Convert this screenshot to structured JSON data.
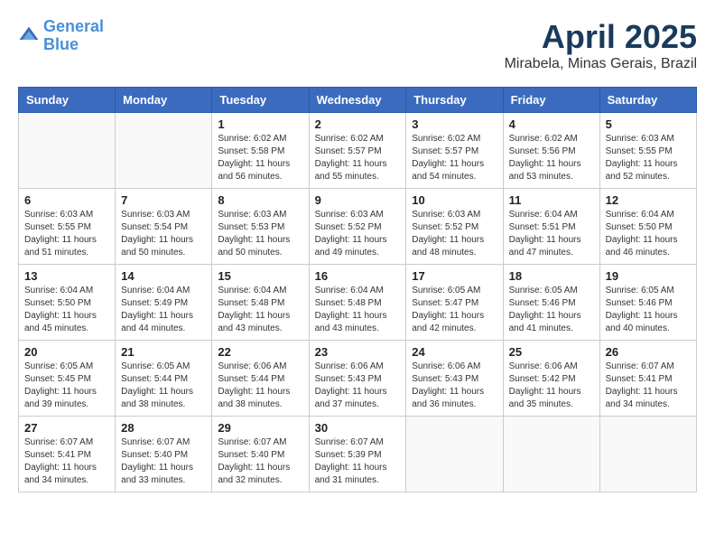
{
  "logo": {
    "line1": "General",
    "line2": "Blue"
  },
  "title": "April 2025",
  "subtitle": "Mirabela, Minas Gerais, Brazil",
  "days_of_week": [
    "Sunday",
    "Monday",
    "Tuesday",
    "Wednesday",
    "Thursday",
    "Friday",
    "Saturday"
  ],
  "weeks": [
    [
      {
        "day": "",
        "detail": ""
      },
      {
        "day": "",
        "detail": ""
      },
      {
        "day": "1",
        "detail": "Sunrise: 6:02 AM\nSunset: 5:58 PM\nDaylight: 11 hours and 56 minutes."
      },
      {
        "day": "2",
        "detail": "Sunrise: 6:02 AM\nSunset: 5:57 PM\nDaylight: 11 hours and 55 minutes."
      },
      {
        "day": "3",
        "detail": "Sunrise: 6:02 AM\nSunset: 5:57 PM\nDaylight: 11 hours and 54 minutes."
      },
      {
        "day": "4",
        "detail": "Sunrise: 6:02 AM\nSunset: 5:56 PM\nDaylight: 11 hours and 53 minutes."
      },
      {
        "day": "5",
        "detail": "Sunrise: 6:03 AM\nSunset: 5:55 PM\nDaylight: 11 hours and 52 minutes."
      }
    ],
    [
      {
        "day": "6",
        "detail": "Sunrise: 6:03 AM\nSunset: 5:55 PM\nDaylight: 11 hours and 51 minutes."
      },
      {
        "day": "7",
        "detail": "Sunrise: 6:03 AM\nSunset: 5:54 PM\nDaylight: 11 hours and 50 minutes."
      },
      {
        "day": "8",
        "detail": "Sunrise: 6:03 AM\nSunset: 5:53 PM\nDaylight: 11 hours and 50 minutes."
      },
      {
        "day": "9",
        "detail": "Sunrise: 6:03 AM\nSunset: 5:52 PM\nDaylight: 11 hours and 49 minutes."
      },
      {
        "day": "10",
        "detail": "Sunrise: 6:03 AM\nSunset: 5:52 PM\nDaylight: 11 hours and 48 minutes."
      },
      {
        "day": "11",
        "detail": "Sunrise: 6:04 AM\nSunset: 5:51 PM\nDaylight: 11 hours and 47 minutes."
      },
      {
        "day": "12",
        "detail": "Sunrise: 6:04 AM\nSunset: 5:50 PM\nDaylight: 11 hours and 46 minutes."
      }
    ],
    [
      {
        "day": "13",
        "detail": "Sunrise: 6:04 AM\nSunset: 5:50 PM\nDaylight: 11 hours and 45 minutes."
      },
      {
        "day": "14",
        "detail": "Sunrise: 6:04 AM\nSunset: 5:49 PM\nDaylight: 11 hours and 44 minutes."
      },
      {
        "day": "15",
        "detail": "Sunrise: 6:04 AM\nSunset: 5:48 PM\nDaylight: 11 hours and 43 minutes."
      },
      {
        "day": "16",
        "detail": "Sunrise: 6:04 AM\nSunset: 5:48 PM\nDaylight: 11 hours and 43 minutes."
      },
      {
        "day": "17",
        "detail": "Sunrise: 6:05 AM\nSunset: 5:47 PM\nDaylight: 11 hours and 42 minutes."
      },
      {
        "day": "18",
        "detail": "Sunrise: 6:05 AM\nSunset: 5:46 PM\nDaylight: 11 hours and 41 minutes."
      },
      {
        "day": "19",
        "detail": "Sunrise: 6:05 AM\nSunset: 5:46 PM\nDaylight: 11 hours and 40 minutes."
      }
    ],
    [
      {
        "day": "20",
        "detail": "Sunrise: 6:05 AM\nSunset: 5:45 PM\nDaylight: 11 hours and 39 minutes."
      },
      {
        "day": "21",
        "detail": "Sunrise: 6:05 AM\nSunset: 5:44 PM\nDaylight: 11 hours and 38 minutes."
      },
      {
        "day": "22",
        "detail": "Sunrise: 6:06 AM\nSunset: 5:44 PM\nDaylight: 11 hours and 38 minutes."
      },
      {
        "day": "23",
        "detail": "Sunrise: 6:06 AM\nSunset: 5:43 PM\nDaylight: 11 hours and 37 minutes."
      },
      {
        "day": "24",
        "detail": "Sunrise: 6:06 AM\nSunset: 5:43 PM\nDaylight: 11 hours and 36 minutes."
      },
      {
        "day": "25",
        "detail": "Sunrise: 6:06 AM\nSunset: 5:42 PM\nDaylight: 11 hours and 35 minutes."
      },
      {
        "day": "26",
        "detail": "Sunrise: 6:07 AM\nSunset: 5:41 PM\nDaylight: 11 hours and 34 minutes."
      }
    ],
    [
      {
        "day": "27",
        "detail": "Sunrise: 6:07 AM\nSunset: 5:41 PM\nDaylight: 11 hours and 34 minutes."
      },
      {
        "day": "28",
        "detail": "Sunrise: 6:07 AM\nSunset: 5:40 PM\nDaylight: 11 hours and 33 minutes."
      },
      {
        "day": "29",
        "detail": "Sunrise: 6:07 AM\nSunset: 5:40 PM\nDaylight: 11 hours and 32 minutes."
      },
      {
        "day": "30",
        "detail": "Sunrise: 6:07 AM\nSunset: 5:39 PM\nDaylight: 11 hours and 31 minutes."
      },
      {
        "day": "",
        "detail": ""
      },
      {
        "day": "",
        "detail": ""
      },
      {
        "day": "",
        "detail": ""
      }
    ]
  ]
}
